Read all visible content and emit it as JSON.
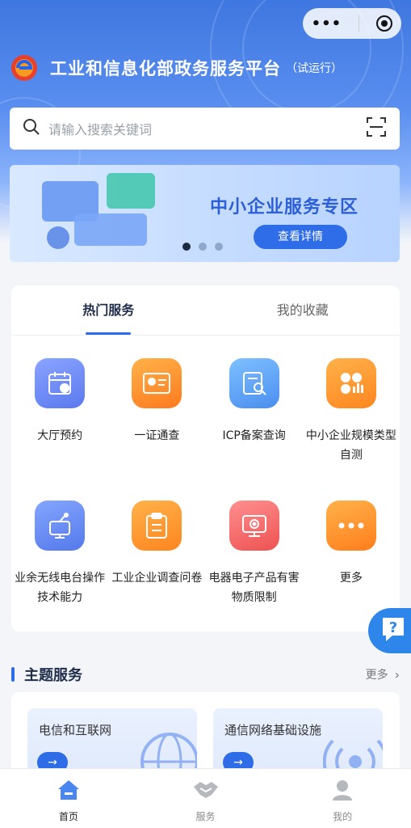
{
  "header": {
    "title": "工业和信息化部政务服务平台",
    "subtitle": "（试运行）"
  },
  "capsule": {
    "more_icon": "more-dots-icon",
    "close_icon": "target-icon"
  },
  "search": {
    "placeholder": "请输入搜索关键词",
    "icon": "search-icon",
    "scan_icon": "scan-icon"
  },
  "banner": {
    "title": "中小企业服务专区",
    "button": "查看详情",
    "pages": 3,
    "active_page": 1
  },
  "service_card": {
    "tabs": [
      {
        "label": "热门服务",
        "active": true
      },
      {
        "label": "我的收藏",
        "active": false
      }
    ],
    "items": [
      {
        "label": "大厅预约",
        "icon": "calendar-icon",
        "color": "#6f8af0"
      },
      {
        "label": "一证通查",
        "icon": "id-card-icon",
        "color": "#ff8a2a"
      },
      {
        "label": "ICP备案查询",
        "icon": "search-document-icon",
        "color": "#5aa2f3"
      },
      {
        "label": "中小企业规模类型自测",
        "icon": "chart-grid-icon",
        "color": "#ff9a2b"
      },
      {
        "label": "业余无线电台操作技术能力",
        "icon": "radio-antenna-icon",
        "color": "#5b8bf0"
      },
      {
        "label": "工业企业调查问卷",
        "icon": "clipboard-icon",
        "color": "#ff9a2b"
      },
      {
        "label": "电器电子产品有害物质限制",
        "icon": "hazard-monitor-icon",
        "color": "#f06a6a"
      },
      {
        "label": "更多",
        "icon": "more-dots-icon",
        "color": "#ff8f2b"
      }
    ]
  },
  "floating": {
    "icon": "help-chat-icon"
  },
  "topics": {
    "title": "主题服务",
    "more": "更多",
    "items": [
      {
        "label": "电信和互联网",
        "icon": "globe-icon"
      },
      {
        "label": "通信网络基础设施",
        "icon": "signal-tower-icon"
      }
    ],
    "go_label": "→"
  },
  "tabbar": {
    "items": [
      {
        "label": "首页",
        "icon": "home-icon",
        "active": true
      },
      {
        "label": "服务",
        "icon": "handshake-icon",
        "active": false
      },
      {
        "label": "我的",
        "icon": "user-icon",
        "active": false
      }
    ]
  },
  "colors": {
    "primary": "#2f6ce8",
    "hero_top": "#3f77e0"
  }
}
